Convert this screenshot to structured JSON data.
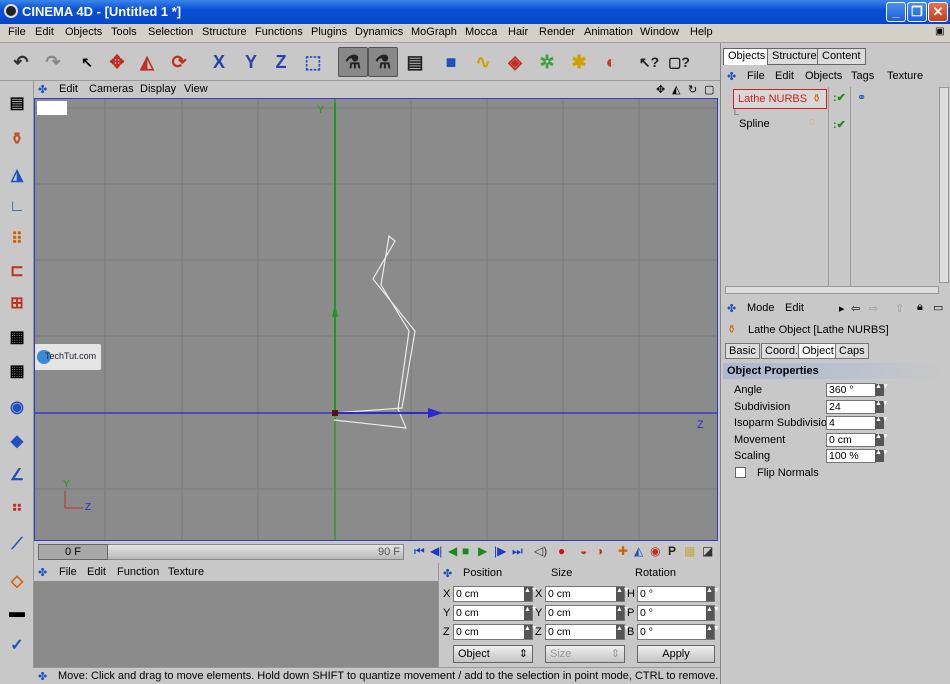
{
  "window": {
    "title": "CINEMA 4D - [Untitled 1 *]"
  },
  "menu": [
    "File",
    "Edit",
    "Objects",
    "Tools",
    "Selection",
    "Structure",
    "Functions",
    "Plugins",
    "Dynamics",
    "MoGraph",
    "Mocca",
    "Hair",
    "Render",
    "Animation",
    "Window",
    "Help"
  ],
  "viewport": {
    "menu": [
      "Edit",
      "Cameras",
      "Display",
      "View"
    ],
    "axis_y": "Y",
    "axis_z": "Z",
    "gizmo_y": "Y",
    "gizmo_z": "Z",
    "watermark": "TechTut.com"
  },
  "timeline": {
    "start": "0 F",
    "end": "90 F"
  },
  "material": {
    "menu": [
      "File",
      "Edit",
      "Function",
      "Texture"
    ]
  },
  "coords": {
    "headers": [
      "Position",
      "Size",
      "Rotation"
    ],
    "rows": [
      {
        "a": "X",
        "av": "0 cm",
        "b": "X",
        "bv": "0 cm",
        "c": "H",
        "cv": "0 °"
      },
      {
        "a": "Y",
        "av": "0 cm",
        "b": "Y",
        "bv": "0 cm",
        "c": "P",
        "cv": "0 °"
      },
      {
        "a": "Z",
        "av": "0 cm",
        "b": "Z",
        "bv": "0 cm",
        "c": "B",
        "cv": "0 °"
      }
    ],
    "mode": "Object",
    "size_mode": "Size",
    "apply": "Apply"
  },
  "status": "Move: Click and drag to move elements. Hold down SHIFT to quantize movement / add to the selection in point mode, CTRL to remove.",
  "objects": {
    "tabs": [
      "Objects",
      "Structure",
      "Content"
    ],
    "menu": [
      "File",
      "Edit",
      "Objects",
      "Tags",
      "Texture"
    ],
    "items": [
      "Lathe NURBS",
      "Spline"
    ]
  },
  "attributes": {
    "menu": [
      "Mode",
      "Edit"
    ],
    "title": "Lathe Object [Lathe NURBS]",
    "tabs": [
      "Basic",
      "Coord.",
      "Object",
      "Caps"
    ],
    "section": "Object Properties",
    "props": [
      {
        "label": "Angle",
        "value": "360 °"
      },
      {
        "label": "Subdivision",
        "value": "24"
      },
      {
        "label": "Isoparm Subdivision",
        "value": "4"
      },
      {
        "label": "Movement",
        "value": "0 cm"
      },
      {
        "label": "Scaling",
        "value": "100 %"
      }
    ],
    "flip_normals": "Flip Normals"
  }
}
